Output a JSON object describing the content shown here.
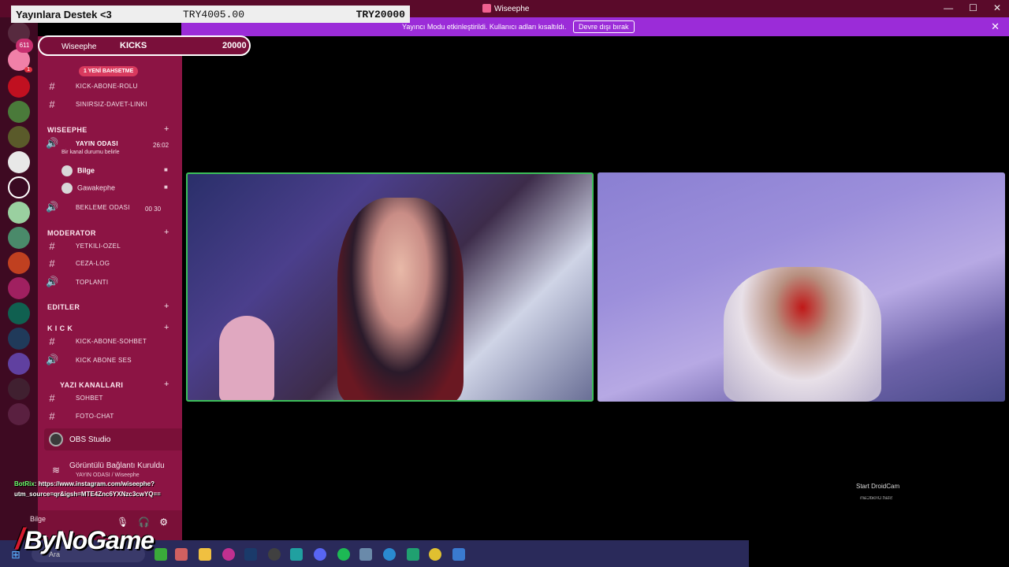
{
  "window": {
    "title": "Wiseephe",
    "controls": [
      "—",
      "☐",
      "✕"
    ]
  },
  "donation": {
    "label": "Yayınlara Destek <3",
    "current": "TRY4005.00",
    "goal": "TRY20000"
  },
  "notice": {
    "text": "Yayıncı Modu etkinleştirildi. Kullanıcı adları kısaltıldı.",
    "button": "Devre dışı bırak",
    "close": "✕"
  },
  "guild": {
    "badge": "611",
    "name": "Wiseephe",
    "kicks_label": "KICKS",
    "kicks_value": "20000"
  },
  "mention_badge": "1 YENİ BAHSETME",
  "channels": {
    "top": [
      {
        "icon": "#",
        "label": "KICK-ABONE-ROLU"
      },
      {
        "icon": "#",
        "label": "SINIRSIZ-DAVET-LINKI"
      }
    ],
    "cat1": "WISEEPHE",
    "voice_active": {
      "label": "YAYIN ODASI",
      "time": "26:02",
      "status": "Bir kanal durumu belirle"
    },
    "users": [
      {
        "name": "Bilge"
      },
      {
        "name": "Gawakephe"
      }
    ],
    "waiting": {
      "label": "BEKLEME ODASI",
      "count_a": "00",
      "count_b": "30"
    },
    "cat2": "MODERATOR",
    "mod": [
      {
        "icon": "#",
        "label": "YETKILI-OZEL"
      },
      {
        "icon": "#",
        "label": "CEZA-LOG"
      },
      {
        "icon": "🔊",
        "label": "TOPLANTI"
      }
    ],
    "cat3": "EDITLER",
    "cat4": "K I C K",
    "kick": [
      {
        "icon": "#",
        "label": "KICK-ABONE-SOHBET"
      },
      {
        "icon": "🔊",
        "label": "KICK ABONE SES"
      }
    ],
    "cat5": "YAZI KANALLARI",
    "text": [
      {
        "icon": "#",
        "label": "SOHBET"
      },
      {
        "icon": "#",
        "label": "FOTO-CHAT"
      }
    ]
  },
  "obs": {
    "name": "OBS Studio"
  },
  "voice": {
    "status": "Görüntülü Bağlantı Kuruldu",
    "sub": "YAYIN ODASI / Wiseephe"
  },
  "chat": {
    "user": "BotRix",
    "message": ": https://www.instagram.com/wiseephe?utm_source=qr&igsh=MTE4Znc6YXNzc3cwYQ=="
  },
  "userbar": {
    "name": "Bilge"
  },
  "logo": {
    "slash": "/",
    "text": "ByNoGame"
  },
  "droidcam": {
    "label": "Start DroidCam",
    "mirror": "Start DroidCam"
  },
  "taskbar": {
    "search": "Ara"
  },
  "colors": {
    "accent": "#9b2cd8",
    "sidebar": "#8c1444",
    "speaking": "#3cbf5a"
  }
}
